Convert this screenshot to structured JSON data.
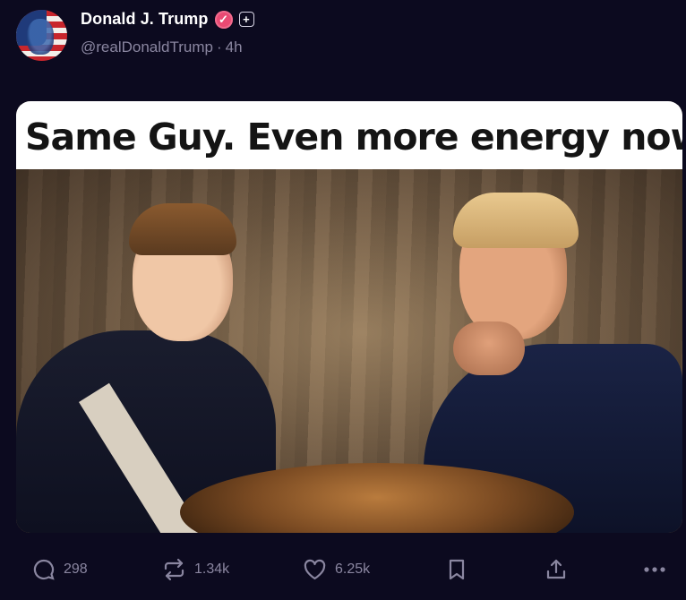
{
  "post": {
    "author_name": "Donald J. Trump",
    "verified_icon": "verified-check-icon",
    "subscribe_icon": "plus-icon",
    "handle": "@realDonaldTrump",
    "separator": "·",
    "time": "4h",
    "image_headline": "Same Guy. Even more energy now!"
  },
  "actions": {
    "replies": "298",
    "reposts": "1.34k",
    "likes": "6.25k"
  },
  "colors": {
    "background": "#0c0a1f",
    "verified_badge": "#ea4a73",
    "muted_text": "#8a86a0"
  }
}
